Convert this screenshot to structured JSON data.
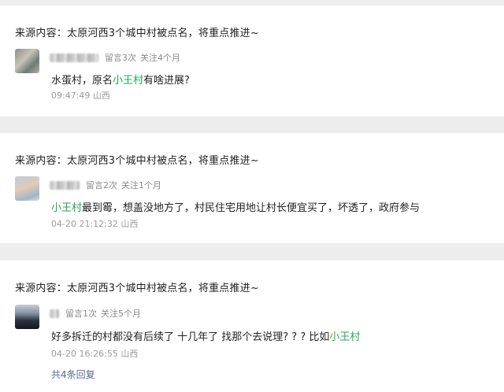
{
  "posts": [
    {
      "source": "来源内容：太原河西3个城中村被点名，将重点推进~",
      "message_count": "留言3次",
      "follow_duration": "关注4个月",
      "comment": {
        "before": "水蛋村，原名",
        "highlight": "小王村",
        "after": "有啥进展?"
      },
      "time": "09:47:49",
      "location": "山西"
    },
    {
      "source": "来源内容：太原河西3个城中村被点名，将重点推进~",
      "message_count": "留言2次",
      "follow_duration": "关注1个月",
      "comment": {
        "before": "",
        "highlight": "小王村",
        "after": "最到霉，想盖没地方了，村民住宅用地让村长便宜买了，坏透了，政府参与"
      },
      "time": "04-20 21:12:32",
      "location": "山西"
    },
    {
      "source": "来源内容：太原河西3个城中村被点名，将重点推进~",
      "message_count": "留言1次",
      "follow_duration": "关注5个月",
      "comment": {
        "before": "好多拆迁的村都没有后续了  十几年了  找那个去说理? ? ?   比如",
        "highlight": "小王村",
        "after": ""
      },
      "time": "04-20 16:26:55",
      "location": "山西",
      "replies_link": "共4条回复"
    }
  ],
  "colors": {
    "background": "#ededed",
    "card": "#ffffff",
    "highlight": "#1fa84f",
    "link": "#576b95"
  }
}
